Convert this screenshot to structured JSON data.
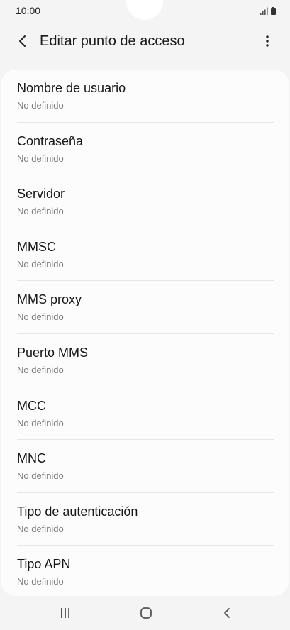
{
  "status_bar": {
    "time": "10:00",
    "icons": [
      "signal-icon",
      "battery-icon"
    ]
  },
  "header": {
    "title": "Editar punto de acceso",
    "back_icon": "back-arrow-icon",
    "menu_icon": "more-vertical-icon"
  },
  "settings": {
    "items": [
      {
        "title": "Nombre de usuario",
        "summary": "No definido"
      },
      {
        "title": "Contraseña",
        "summary": "No definido"
      },
      {
        "title": "Servidor",
        "summary": "No definido"
      },
      {
        "title": "MMSC",
        "summary": "No definido"
      },
      {
        "title": "MMS proxy",
        "summary": "No definido"
      },
      {
        "title": "Puerto MMS",
        "summary": "No definido"
      },
      {
        "title": "MCC",
        "summary": "No definido"
      },
      {
        "title": "MNC",
        "summary": "No definido"
      },
      {
        "title": "Tipo de autenticación",
        "summary": "No definido"
      },
      {
        "title": "Tipo APN",
        "summary": "No definido"
      }
    ]
  },
  "nav_bar": {
    "icons": [
      "recent-apps-icon",
      "home-icon",
      "back-icon"
    ]
  },
  "colors": {
    "background": "#f4f4f4",
    "card": "#fcfcfc",
    "summary_text": "#7c7c7c"
  }
}
